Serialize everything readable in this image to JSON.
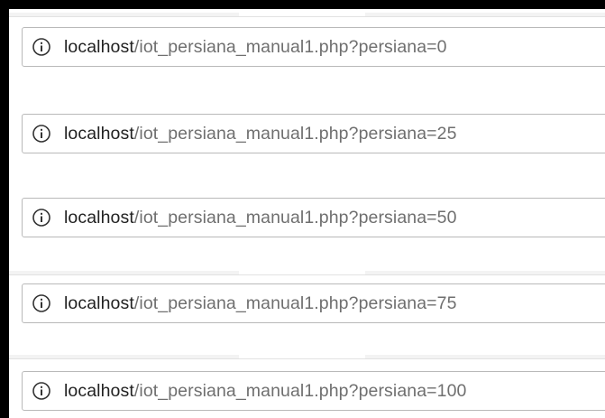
{
  "address_bars": [
    {
      "host": "localhost",
      "path": "/iot_persiana_manual1.php?persiana=0",
      "icon": "info-icon"
    },
    {
      "host": "localhost",
      "path": "/iot_persiana_manual1.php?persiana=25",
      "icon": "info-icon"
    },
    {
      "host": "localhost",
      "path": "/iot_persiana_manual1.php?persiana=50",
      "icon": "info-icon"
    },
    {
      "host": "localhost",
      "path": "/iot_persiana_manual1.php?persiana=75",
      "icon": "info-icon"
    },
    {
      "host": "localhost",
      "path": "/iot_persiana_manual1.php?persiana=100",
      "icon": "info-icon"
    }
  ],
  "colors": {
    "host": "#222222",
    "path": "#6f6f6f",
    "border": "#b9b9b9",
    "frame": "#000000"
  }
}
